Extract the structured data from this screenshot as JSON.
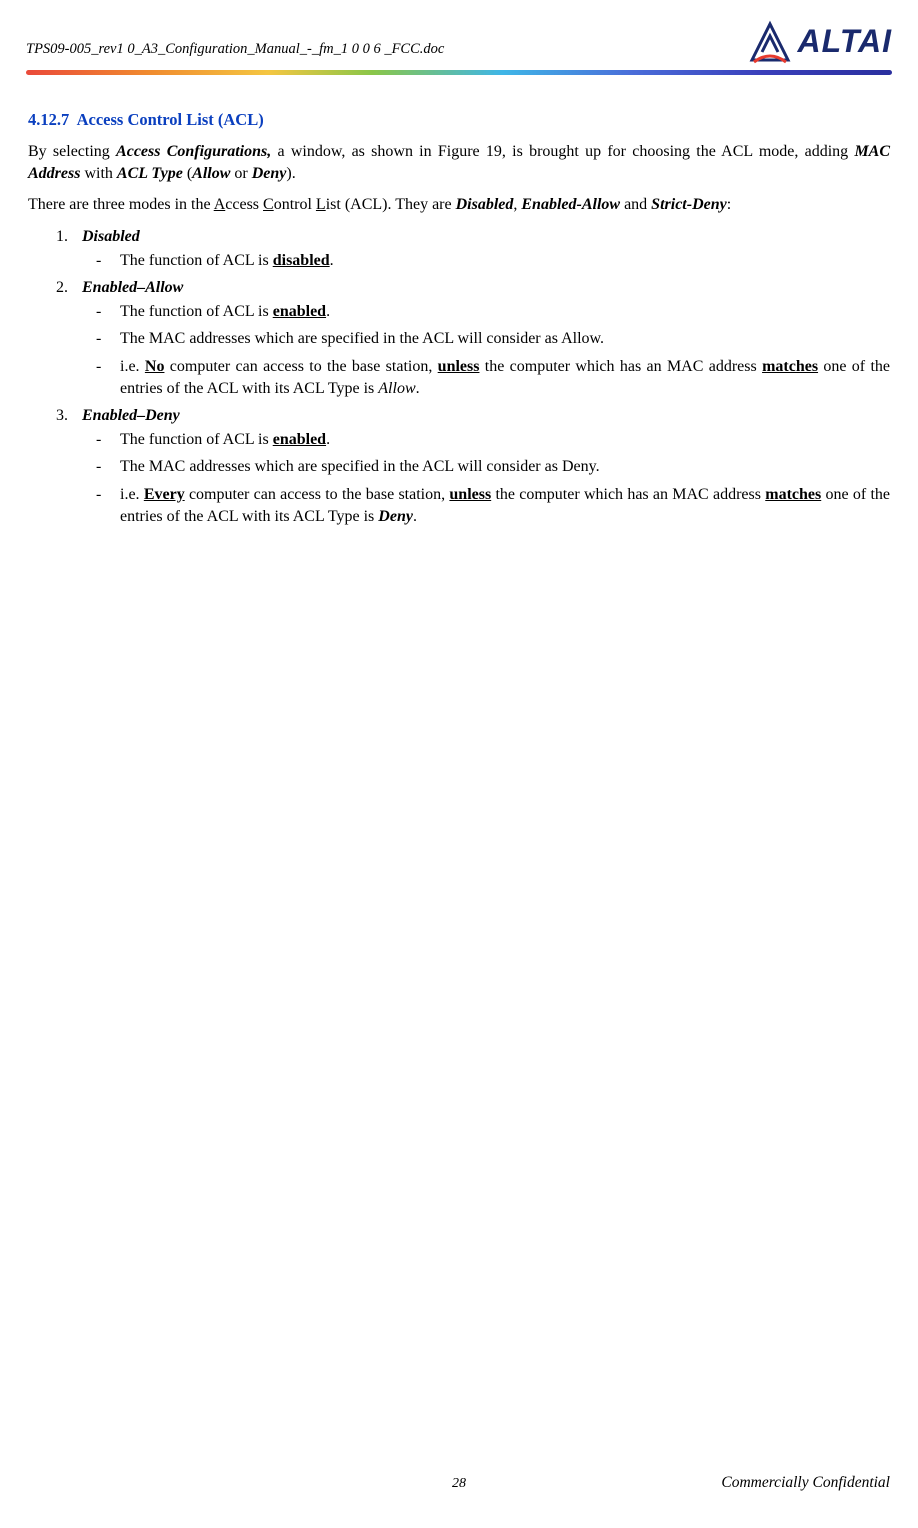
{
  "header": {
    "doc_ref": "TPS09-005_rev1 0_A3_Configuration_Manual_-_fm_1 0 0 6 _FCC.doc",
    "brand": "ALTAI"
  },
  "section": {
    "number": "4.12.7",
    "title": "Access Control List (ACL)"
  },
  "p1": {
    "before_link": "By selecting ",
    "link_text": "Access Configurations,",
    "mid1": " a window, as shown in Figure 19, is brought up for choosing the ACL mode, adding ",
    "mac": "MAC Address",
    "with": " with ",
    "acltype": "ACL Type",
    "paren_open": " (",
    "allow": "Allow",
    "or": " or ",
    "deny": "Deny",
    "close": ")."
  },
  "p2": {
    "pre": "There are three modes in the ",
    "a": "A",
    "a_rest": "ccess ",
    "c": "C",
    "c_rest": "ontrol ",
    "l": "L",
    "l_rest": "ist (ACL). They are ",
    "disabled": "Disabled",
    "comma": ", ",
    "ea": "Enabled-Allow",
    "and": " and ",
    "sd": "Strict-Deny",
    "colon": ":"
  },
  "list": {
    "n1": "1.",
    "n2": "2.",
    "n3": "3.",
    "i1_title": "Disabled",
    "i1_b1a": "The function of ACL is ",
    "i1_b1b": "disabled",
    "dot": ".",
    "i2_title": "Enabled–Allow",
    "i2_b1a": "The function of ACL is ",
    "i2_b1b": "enabled",
    "i2_b2": "The MAC addresses which are specified in the ACL will consider as Allow.",
    "i2_b3_a": "i.e. ",
    "i2_b3_no": "No",
    "i2_b3_b": " computer can access to the base station, ",
    "i2_b3_unless": "unless",
    "i2_b3_c": " the computer which has an MAC address ",
    "i2_b3_matches": "matches",
    "i2_b3_d": " one of the entries of the ACL with its ACL Type is ",
    "i2_b3_allow": "Allow",
    "i3_title": "Enabled–Deny",
    "i3_b1a": "The function of ACL is ",
    "i3_b1b": "enabled",
    "i3_b2": "The MAC addresses which are specified in the ACL will consider as Deny.",
    "i3_b3_a": "i.e. ",
    "i3_b3_every": "Every",
    "i3_b3_b": " computer can access to the base station, ",
    "i3_b3_unless": "unless",
    "i3_b3_c": " the computer which has an MAC address ",
    "i3_b3_matches": "matches",
    "i3_b3_d": " one of the entries of the ACL with its ACL Type is ",
    "i3_b3_deny": "Deny"
  },
  "footer": {
    "page": "28",
    "confidential": "Commercially Confidential"
  }
}
